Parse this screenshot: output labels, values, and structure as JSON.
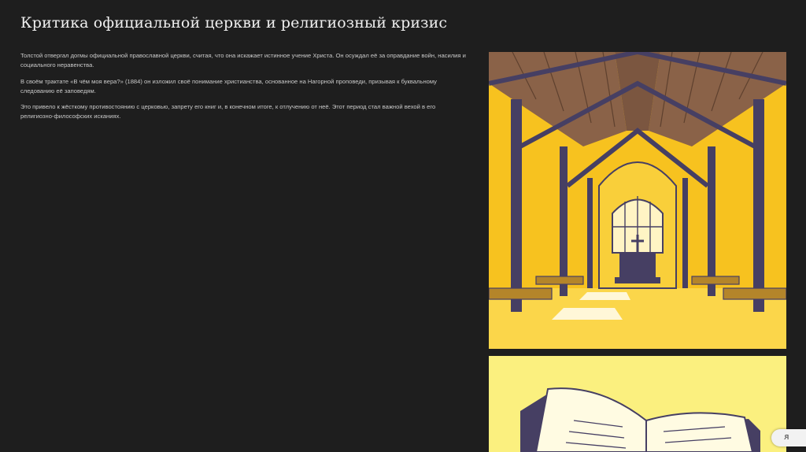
{
  "slide": {
    "title": "Критика официальной церкви и религиозный кризис",
    "paragraphs": [
      "Толстой отвергал догмы официальной православной церкви, считая, что она искажает истинное учение Христа. Он осуждал её за оправдание войн, насилия и социального неравенства.",
      "В своём трактате «В чём моя вера?» (1884) он изложил своё понимание христианства, основанное на Нагорной проповеди, призывая к буквальному следованию её заповедям.",
      "Это привело к жёсткому противостоянию с церковью, запрету его книг и, в конечном итоге, к отлучению от неё. Этот период стал важной вехой в его религиозно-философских исканиях."
    ]
  },
  "illustrations": {
    "church": {
      "icon": "church-interior-illustration"
    },
    "book": {
      "icon": "open-book-illustration"
    }
  },
  "widget": {
    "icon": "zoom-icon",
    "glyph": "ᴙ"
  },
  "colors": {
    "background": "#1e1e1e",
    "title": "#f0f0f0",
    "text": "#c9c9c9",
    "church_yellow": "#f7c21f",
    "wood_brown": "#8a6248",
    "beam_navy": "#463f63",
    "book_yellow": "#fbf07f"
  }
}
